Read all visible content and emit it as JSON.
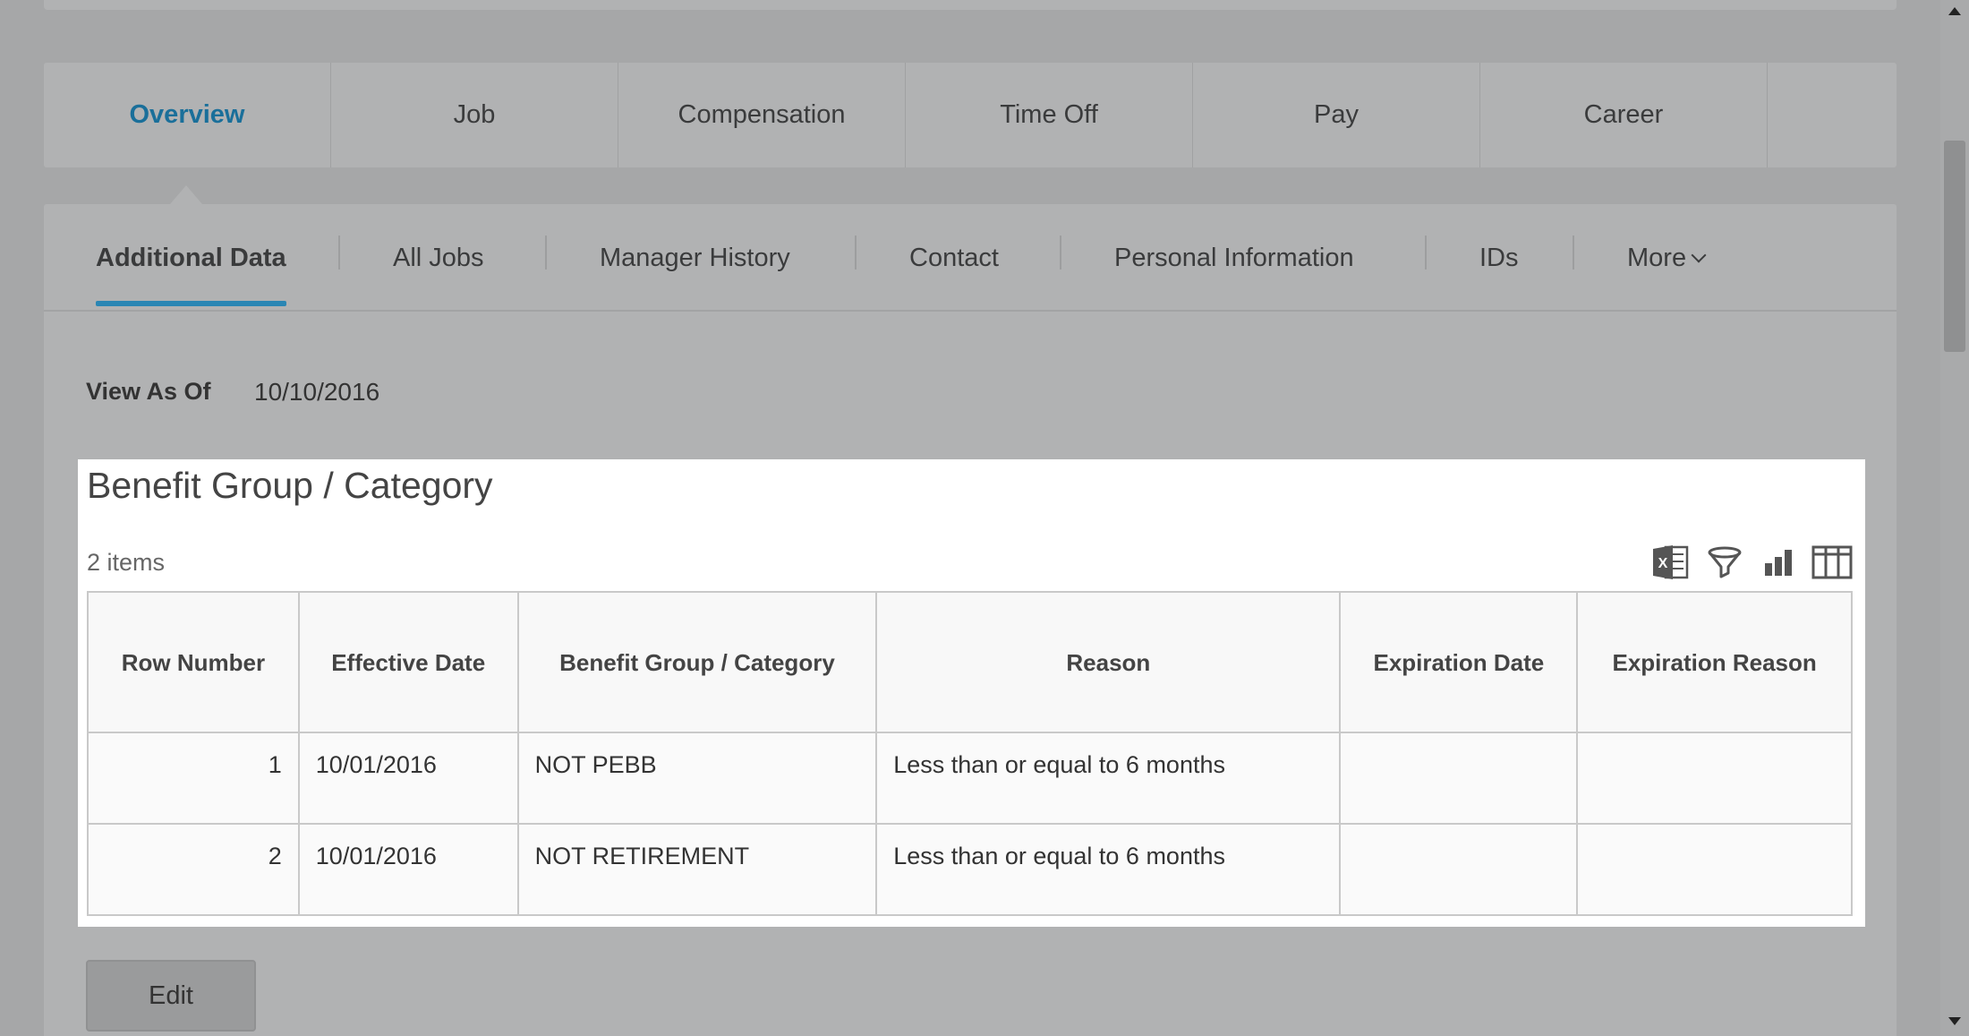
{
  "main_tabs": [
    {
      "label": "Overview",
      "active": true
    },
    {
      "label": "Job"
    },
    {
      "label": "Compensation"
    },
    {
      "label": "Time Off"
    },
    {
      "label": "Pay"
    },
    {
      "label": "Career"
    }
  ],
  "sub_tabs": [
    {
      "label": "Additional Data",
      "active": true
    },
    {
      "label": "All Jobs"
    },
    {
      "label": "Manager History"
    },
    {
      "label": "Contact"
    },
    {
      "label": "Personal Information"
    },
    {
      "label": "IDs"
    },
    {
      "label": "More"
    }
  ],
  "view_as": {
    "label": "View As Of",
    "value": "10/10/2016"
  },
  "grid": {
    "title": "Benefit Group / Category",
    "count": "2 items",
    "icons": [
      "excel-export-icon",
      "filter-icon",
      "chart-icon",
      "columns-icon"
    ],
    "columns": [
      "Row Number",
      "Effective Date",
      "Benefit Group / Category",
      "Reason",
      "Expiration Date",
      "Expiration Reason"
    ],
    "rows": [
      [
        "1",
        "10/01/2016",
        "NOT PEBB",
        "Less than or equal to 6 months",
        "",
        ""
      ],
      [
        "2",
        "10/01/2016",
        "NOT RETIREMENT",
        "Less than or equal to 6 months",
        "",
        ""
      ]
    ]
  },
  "edit_label": "Edit",
  "colors": {
    "accent": "#1a6f9a",
    "underline": "#2a86b4",
    "overlay": "#a6a7a8"
  }
}
